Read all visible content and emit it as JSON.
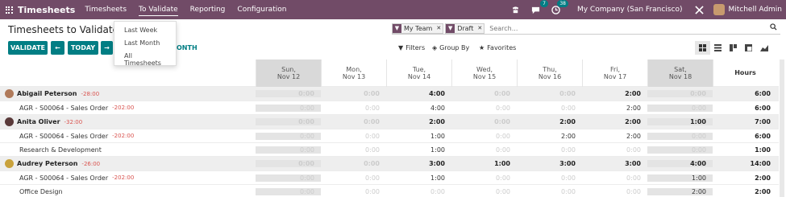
{
  "nav": {
    "brand": "Timesheets",
    "menus": [
      "Timesheets",
      "To Validate",
      "Reporting",
      "Configuration"
    ],
    "chat_badge": "7",
    "activity_badge": "38",
    "company": "My Company (San Francisco)",
    "user": "Mitchell Admin"
  },
  "page": {
    "title": "Timesheets to Validate"
  },
  "toolbar": {
    "validate": "VALIDATE",
    "prev": "←",
    "today": "TODAY",
    "next": "→",
    "range_fragment": "ONTH"
  },
  "search": {
    "facets": [
      {
        "label": "My Team"
      },
      {
        "label": "Draft"
      }
    ],
    "placeholder": "Search..."
  },
  "search_panel": {
    "filters": "Filters",
    "group_by": "Group By",
    "favorites": "Favorites"
  },
  "dropdown": {
    "items": [
      "Last Week",
      "Last Month",
      "All Timesheets"
    ]
  },
  "grid": {
    "columns": [
      {
        "day": "Sun,",
        "date": "Nov 12",
        "weekend": true
      },
      {
        "day": "Mon,",
        "date": "Nov 13",
        "weekend": false
      },
      {
        "day": "Tue,",
        "date": "Nov 14",
        "weekend": false
      },
      {
        "day": "Wed,",
        "date": "Nov 15",
        "weekend": false
      },
      {
        "day": "Thu,",
        "date": "Nov 16",
        "weekend": false
      },
      {
        "day": "Fri,",
        "date": "Nov 17",
        "weekend": false
      },
      {
        "day": "Sat,",
        "date": "Nov 18",
        "weekend": true
      }
    ],
    "total_label": "Hours",
    "rows": [
      {
        "kind": "group",
        "name": "Abigail Peterson",
        "diff": "-28:00",
        "avatar_color": "#b07a5a",
        "values": [
          "0:00",
          "0:00",
          "4:00",
          "0:00",
          "0:00",
          "2:00",
          "0:00"
        ],
        "total": "6:00"
      },
      {
        "kind": "sub",
        "name": "AGR - S00064 - Sales Order",
        "diff": "-202:00",
        "values": [
          "0:00",
          "0:00",
          "4:00",
          "0:00",
          "0:00",
          "2:00",
          "0:00"
        ],
        "total": "6:00"
      },
      {
        "kind": "group",
        "name": "Anita Oliver",
        "diff": "-32:00",
        "avatar_color": "#5a3a3a",
        "values": [
          "0:00",
          "0:00",
          "2:00",
          "0:00",
          "2:00",
          "2:00",
          "1:00"
        ],
        "total": "7:00"
      },
      {
        "kind": "sub",
        "name": "AGR - S00064 - Sales Order",
        "diff": "-202:00",
        "values": [
          "0:00",
          "0:00",
          "1:00",
          "0:00",
          "2:00",
          "2:00",
          "0:00"
        ],
        "total": "6:00"
      },
      {
        "kind": "sub",
        "name": "Research & Development",
        "diff": "",
        "values": [
          "0:00",
          "0:00",
          "1:00",
          "0:00",
          "0:00",
          "0:00",
          "0:00"
        ],
        "total": "1:00"
      },
      {
        "kind": "group",
        "name": "Audrey Peterson",
        "diff": "-26:00",
        "avatar_color": "#c9a23c",
        "values": [
          "0:00",
          "0:00",
          "3:00",
          "1:00",
          "3:00",
          "3:00",
          "4:00"
        ],
        "total": "14:00"
      },
      {
        "kind": "sub",
        "name": "AGR - S00064 - Sales Order",
        "diff": "-202:00",
        "values": [
          "0:00",
          "0:00",
          "1:00",
          "0:00",
          "0:00",
          "0:00",
          "1:00"
        ],
        "total": "2:00"
      },
      {
        "kind": "sub",
        "name": "Office Design",
        "diff": "",
        "values": [
          "0:00",
          "0:00",
          "0:00",
          "0:00",
          "0:00",
          "0:00",
          "2:00"
        ],
        "total": "2:00"
      }
    ]
  },
  "colors": {
    "brand": "#714b67",
    "primary": "#017e84",
    "negative": "#d9534f"
  }
}
